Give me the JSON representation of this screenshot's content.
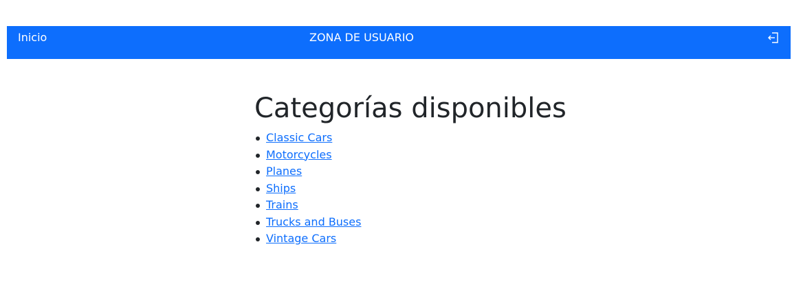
{
  "navbar": {
    "home_label": "Inicio",
    "title": "ZONA DE USUARIO",
    "logout_icon": "logout-icon",
    "background": "#0d6efd"
  },
  "main": {
    "heading": "Categorías disponibles",
    "categories": [
      {
        "label": "Classic Cars"
      },
      {
        "label": "Motorcycles"
      },
      {
        "label": "Planes"
      },
      {
        "label": "Ships"
      },
      {
        "label": "Trains"
      },
      {
        "label": "Trucks and Buses"
      },
      {
        "label": "Vintage Cars"
      }
    ],
    "link_color": "#0d6efd"
  }
}
